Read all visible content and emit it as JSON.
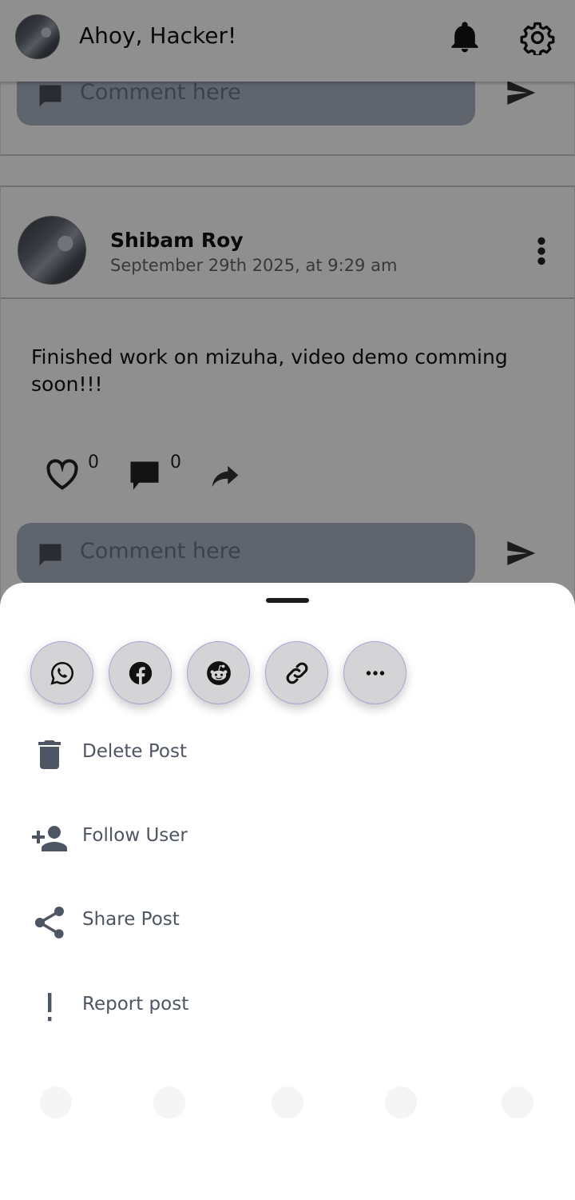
{
  "header": {
    "greeting": "Ahoy, Hacker!"
  },
  "comment_box": {
    "placeholder": "Comment here"
  },
  "post": {
    "author": "Shibam Roy",
    "date": "September 29th 2025, at 9:29 am",
    "text": "Finished work on mizuha, video demo comming soon!!!",
    "likes": "0",
    "comments": "0"
  },
  "sheet": {
    "share_targets": [
      {
        "icon": "whatsapp-icon"
      },
      {
        "icon": "facebook-icon"
      },
      {
        "icon": "reddit-icon"
      },
      {
        "icon": "link-icon"
      },
      {
        "icon": "more-icon"
      }
    ],
    "items": [
      {
        "label": "Delete Post",
        "icon": "trash-icon"
      },
      {
        "label": "Follow User",
        "icon": "person-add-icon"
      },
      {
        "label": "Share Post",
        "icon": "share-icon"
      },
      {
        "label": "Report post",
        "icon": "exclamation-icon"
      }
    ]
  },
  "colors": {
    "scrim": "#000000",
    "comment_box": "#aab3c2",
    "share_button": "#d4d4d6",
    "menu_text": "#4e5563"
  }
}
